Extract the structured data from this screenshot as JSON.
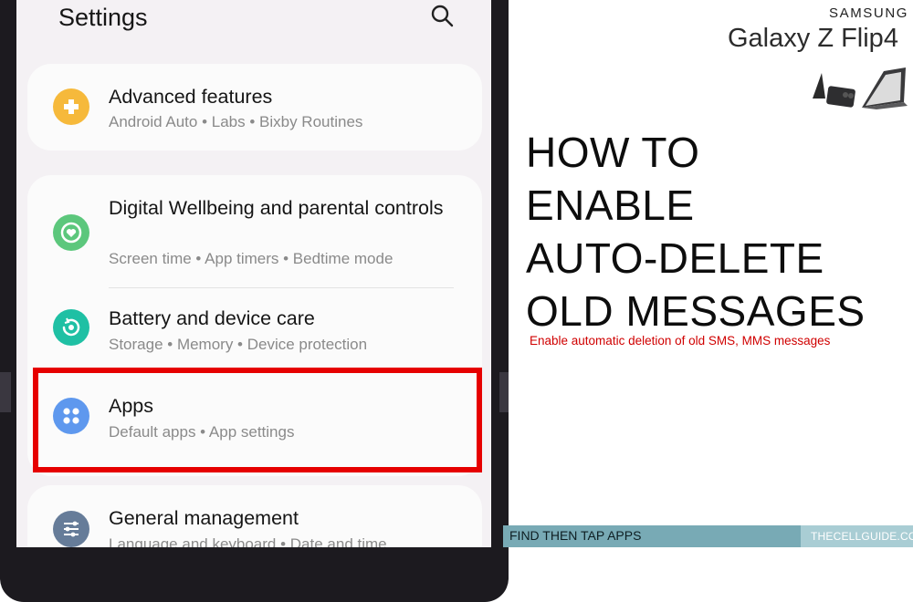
{
  "settings": {
    "title": "Settings",
    "search_icon": "search-icon"
  },
  "items": [
    {
      "title": "Advanced features",
      "subtitle": "Android Auto  •  Labs  •  Bixby Routines",
      "icon": "plus-puzzle-icon",
      "color": "#f6b93b"
    },
    {
      "title": "Digital Wellbeing and parental controls",
      "subtitle": "Screen time  •  App timers  •  Bedtime mode",
      "icon": "wellbeing-heart-icon",
      "color": "#5cc77c"
    },
    {
      "title": "Battery and device care",
      "subtitle": "Storage  •  Memory  •  Device protection",
      "icon": "device-care-icon",
      "color": "#1fc0a4"
    },
    {
      "title": "Apps",
      "subtitle": "Default apps  •  App settings",
      "icon": "apps-grid-icon",
      "color": "#5e98ee"
    },
    {
      "title": "General management",
      "subtitle": "Language and keyboard  •  Date and time",
      "icon": "sliders-icon",
      "color": "#667c99"
    }
  ],
  "banner": {
    "brand": "SAMSUNG",
    "model": "Galaxy Z Flip4",
    "headline": [
      "HOW TO",
      "ENABLE",
      "AUTO-DELETE",
      "OLD MESSAGES"
    ],
    "subline": "Enable automatic deletion of old SMS, MMS messages",
    "footer_instruction": "FIND THEN TAP APPS",
    "footer_site": "THECELLGUIDE.COM",
    "colors": {
      "highlight": "#e60000",
      "subline": "#d00000",
      "footer": "#78aab5"
    }
  }
}
